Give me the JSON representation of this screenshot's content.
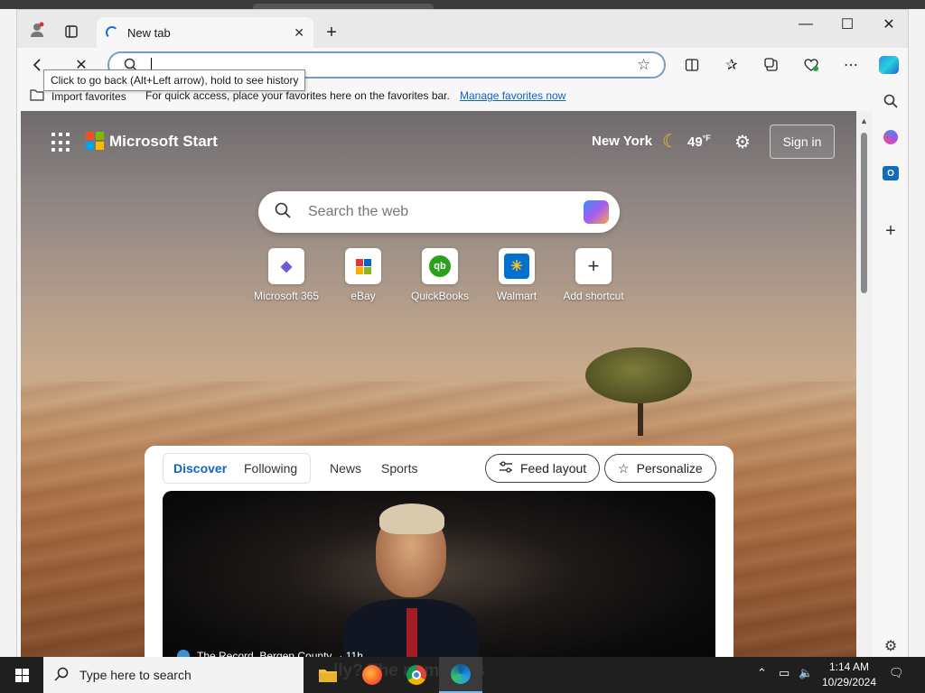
{
  "browser": {
    "tab_title": "New tab",
    "tooltip": "Click to go back (Alt+Left arrow), hold to see history"
  },
  "favorites_bar": {
    "import_label": "Import favorites",
    "message": "For quick access, place your favorites here on the favorites bar.",
    "manage_link": "Manage favorites now"
  },
  "start_page": {
    "brand": "Microsoft Start",
    "city": "New York",
    "temperature": "49",
    "temp_unit": "°F",
    "signin_label": "Sign in",
    "search_placeholder": "Search the web",
    "shortcuts": [
      {
        "label": "Microsoft 365",
        "icon": "m365-icon",
        "glyph": "◆",
        "color": "#6b5bd6"
      },
      {
        "label": "eBay",
        "icon": "ebay-icon",
        "glyph": "▤",
        "color": "#e53238"
      },
      {
        "label": "QuickBooks",
        "icon": "quickbooks-icon",
        "glyph": "qb",
        "color": "#2ca01c"
      },
      {
        "label": "Walmart",
        "icon": "walmart-icon",
        "glyph": "✳",
        "color": "#0071ce"
      },
      {
        "label": "Add shortcut",
        "icon": "plus-icon",
        "glyph": "+",
        "color": "#333333"
      }
    ]
  },
  "feed": {
    "tab_discover": "Discover",
    "tab_following": "Following",
    "tab_news": "News",
    "tab_sports": "Sports",
    "feed_layout_label": "Feed layout",
    "personalize_label": "Personalize",
    "source": "The Record, Bergen County",
    "age": "· 11h",
    "headline": "…lly? The number is"
  },
  "taskbar": {
    "search_placeholder": "Type here to search",
    "time": "1:14 AM",
    "date": "10/29/2024"
  },
  "colors": {
    "accent": "#1164c4",
    "taskbar": "#1f1f1f"
  }
}
